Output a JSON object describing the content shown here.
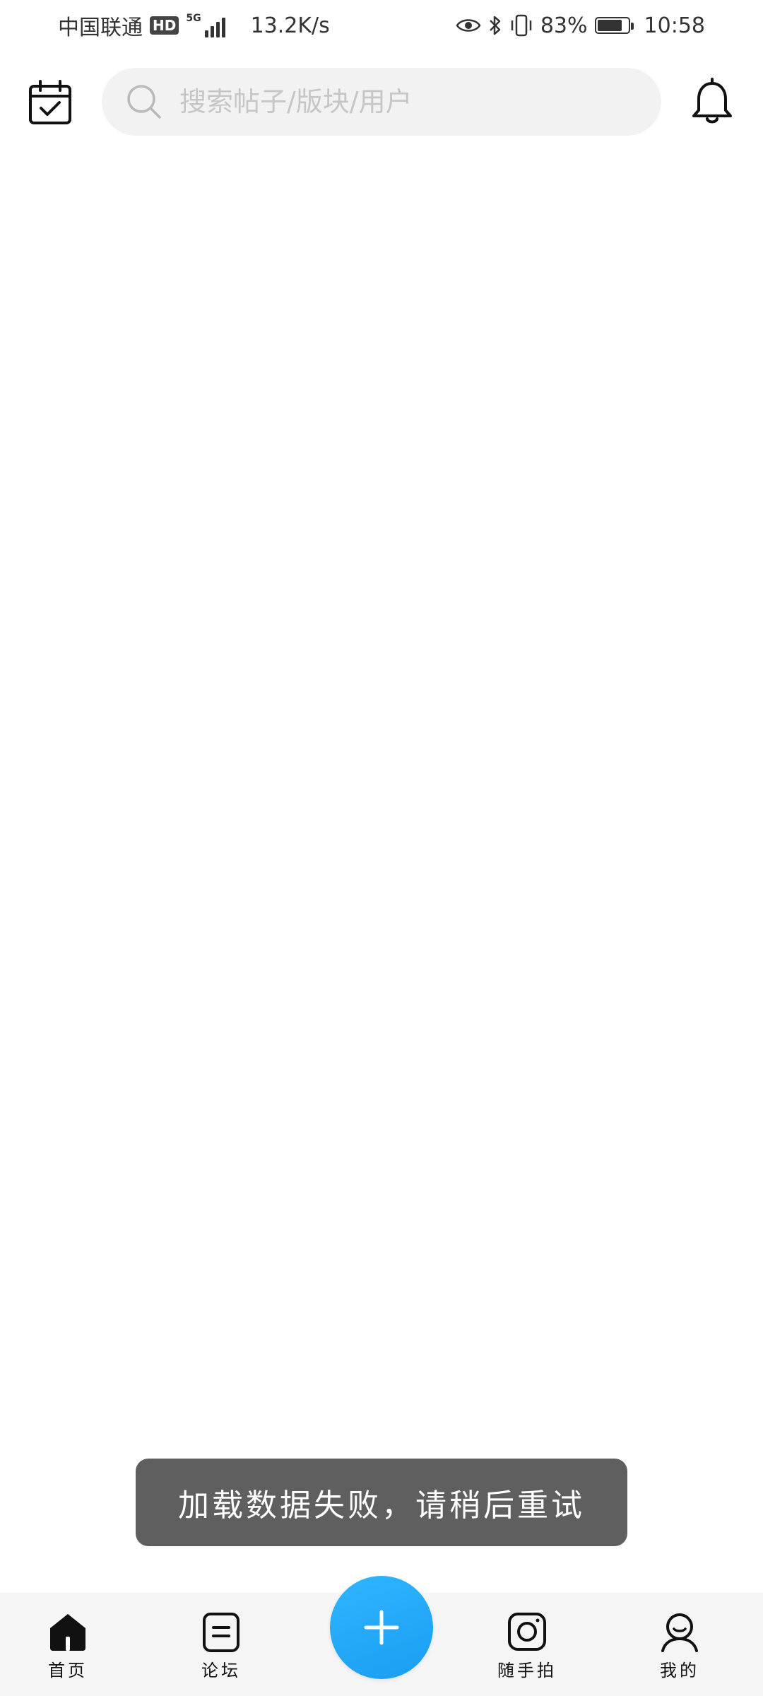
{
  "status_bar": {
    "carrier": "中国联通",
    "hd_badge": "HD",
    "network_type": "5G",
    "net_speed": "13.2K/s",
    "battery_percent": "83%",
    "battery_level": 0.83,
    "time": "10:58",
    "icons": [
      "eye-icon",
      "bluetooth-icon",
      "vibrate-icon",
      "battery-icon"
    ]
  },
  "header": {
    "calendar_icon": "calendar-check-icon",
    "search": {
      "placeholder": "搜索帖子/版块/用户",
      "value": ""
    },
    "notification_icon": "bell-icon"
  },
  "toast": {
    "message": "加载数据失败，请稍后重试"
  },
  "bottom_nav": {
    "items": [
      {
        "label": "首页",
        "icon": "home-icon",
        "active": true
      },
      {
        "label": "论坛",
        "icon": "forum-icon",
        "active": false
      },
      {
        "label": "随手拍",
        "icon": "camera-icon",
        "active": false
      },
      {
        "label": "我的",
        "icon": "user-icon",
        "active": false
      }
    ],
    "fab_icon": "plus-icon"
  },
  "colors": {
    "accent": "#1a9df2",
    "toast_bg": "#5f5f5f",
    "search_bg": "#f2f2f2",
    "nav_bg": "#f5f5f5"
  }
}
